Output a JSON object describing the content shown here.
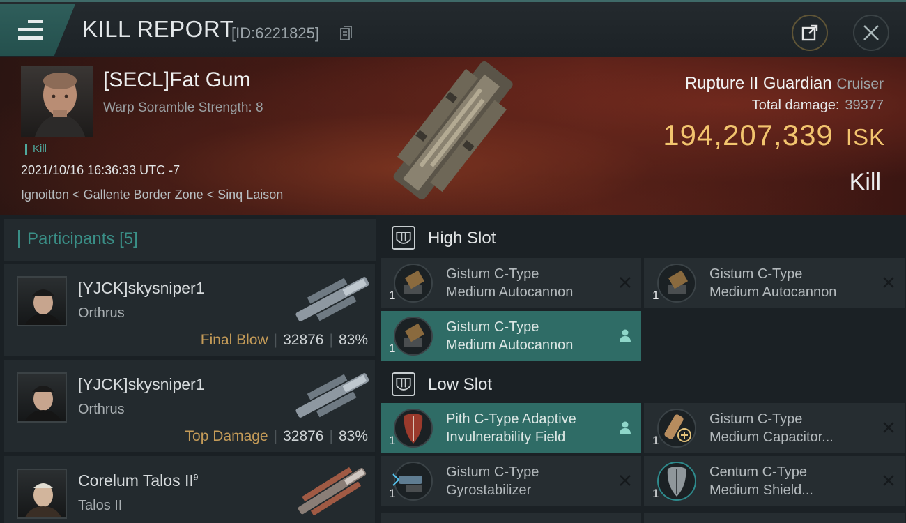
{
  "header": {
    "title": "KILL REPORT",
    "report_id": "[ID:6221825]",
    "menu_icon": "hamburger-menu-icon",
    "share_icon": "share-external-icon",
    "close_icon": "close-icon"
  },
  "victim": {
    "name": "[SECL]Fat Gum",
    "warp_scramble": "Warp Soramble Strength: 8",
    "kill_tag": "Kill",
    "datetime": "2021/10/16 16:36:33 UTC -7",
    "location": "Ignoitton < Gallente Border Zone < Sinq Laison",
    "ship_name": "Rupture II Guardian",
    "ship_class": "Cruiser",
    "total_damage_label": "Total damage:",
    "total_damage_value": "39377",
    "isk_value": "194,207,339",
    "isk_unit": "ISK",
    "result": "Kill"
  },
  "participants": {
    "title": "Participants",
    "count": "[5]",
    "rows": [
      {
        "name": "[YJCK]skysniper1",
        "ship": "Orthrus",
        "tag": "Final Blow",
        "damage": "32876",
        "percent": "83%"
      },
      {
        "name": "[YJCK]skysniper1",
        "ship": "Orthrus",
        "tag": "Top Damage",
        "damage": "32876",
        "percent": "83%"
      },
      {
        "name": "Corelum Talos II",
        "sup": "9",
        "ship": "Talos II"
      }
    ]
  },
  "slots": {
    "high": {
      "title": "High Slot",
      "modules": [
        {
          "line1": "Gistum C-Type",
          "line2": "Medium Autocannon",
          "qty": "1",
          "action": "x"
        },
        {
          "line1": "Gistum C-Type",
          "line2": "Medium Autocannon",
          "qty": "1",
          "action": "x"
        },
        {
          "line1": "Gistum C-Type",
          "line2": "Medium Autocannon",
          "qty": "1",
          "action": "person"
        }
      ]
    },
    "low": {
      "title": "Low Slot",
      "modules": [
        {
          "line1": "Pith C-Type Adaptive",
          "line2": "Invulnerability Field",
          "qty": "1",
          "action": "person"
        },
        {
          "line1": "Gistum C-Type",
          "line2": "Medium Capacitor...",
          "qty": "1",
          "action": "x"
        },
        {
          "line1": "Gistum C-Type",
          "line2": "Gyrostabilizer",
          "qty": "1",
          "action": "x"
        },
        {
          "line1": "Centum C-Type",
          "line2": "Medium Shield...",
          "qty": "1",
          "action": "x"
        }
      ]
    }
  },
  "colors": {
    "accent_teal": "#3a8f87",
    "isk_gold": "#f2c46e",
    "tag_gold": "#c49b58",
    "active_row": "#2f6c66"
  }
}
